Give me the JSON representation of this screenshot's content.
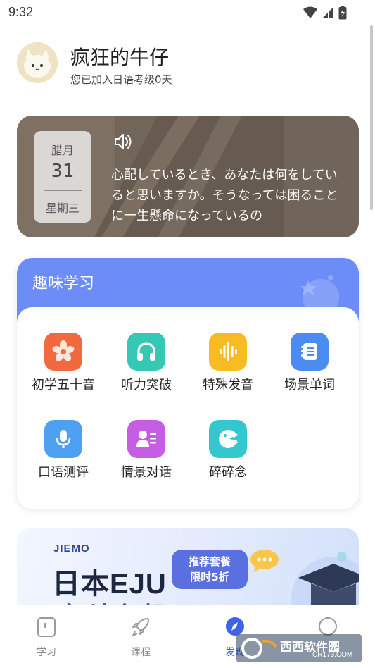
{
  "status_bar": {
    "time": "9:32",
    "icons": [
      "wifi-icon",
      "signal-icon",
      "battery-icon"
    ]
  },
  "profile": {
    "username": "疯狂的牛仔",
    "join_text": "您已加入日语考级0天",
    "avatar": "avatar-icon"
  },
  "daily": {
    "lunar_month": "腊月",
    "day": "31",
    "weekday": "星期三",
    "quote": "心配しているとき、あなたは何をしていると思いますか。そうなっては困ることに一生懸命になっているの",
    "speaker_icon": "speaker-icon"
  },
  "fun_learning": {
    "title": "趣味学习",
    "items": [
      {
        "label": "初学五十音",
        "icon": "sakura-icon",
        "color": "#f06a3e"
      },
      {
        "label": "听力突破",
        "icon": "headphones-icon",
        "color": "#35c8b4"
      },
      {
        "label": "特殊发音",
        "icon": "soundwave-icon",
        "color": "#f8bb24"
      },
      {
        "label": "场景单词",
        "icon": "notebook-icon",
        "color": "#4a8cf2"
      },
      {
        "label": "口语测评",
        "icon": "microphone-icon",
        "color": "#4ea0f2"
      },
      {
        "label": "情景对话",
        "icon": "dialogue-icon",
        "color": "#c65ee3"
      },
      {
        "label": "碎碎念",
        "icon": "chat-face-icon",
        "color": "#35c7cf"
      }
    ]
  },
  "banner": {
    "brand": "JIEMO",
    "title": "日本EJU",
    "subtitle": "全科套餐",
    "tag_line1": "推荐套餐",
    "tag_line2": "限时5折"
  },
  "bottom_nav": {
    "items": [
      {
        "label": "学习",
        "icon": "book-icon",
        "active": false
      },
      {
        "label": "课程",
        "icon": "rocket-icon",
        "active": false
      },
      {
        "label": "发现",
        "icon": "compass-icon",
        "active": true
      },
      {
        "label": "",
        "icon": "profile-circle-icon",
        "active": false
      }
    ]
  },
  "watermark": {
    "text": "西西软件园",
    "url": "CR173.COM"
  },
  "colors": {
    "accent_blue": "#6c8df7",
    "active_nav": "#3f63e8"
  }
}
